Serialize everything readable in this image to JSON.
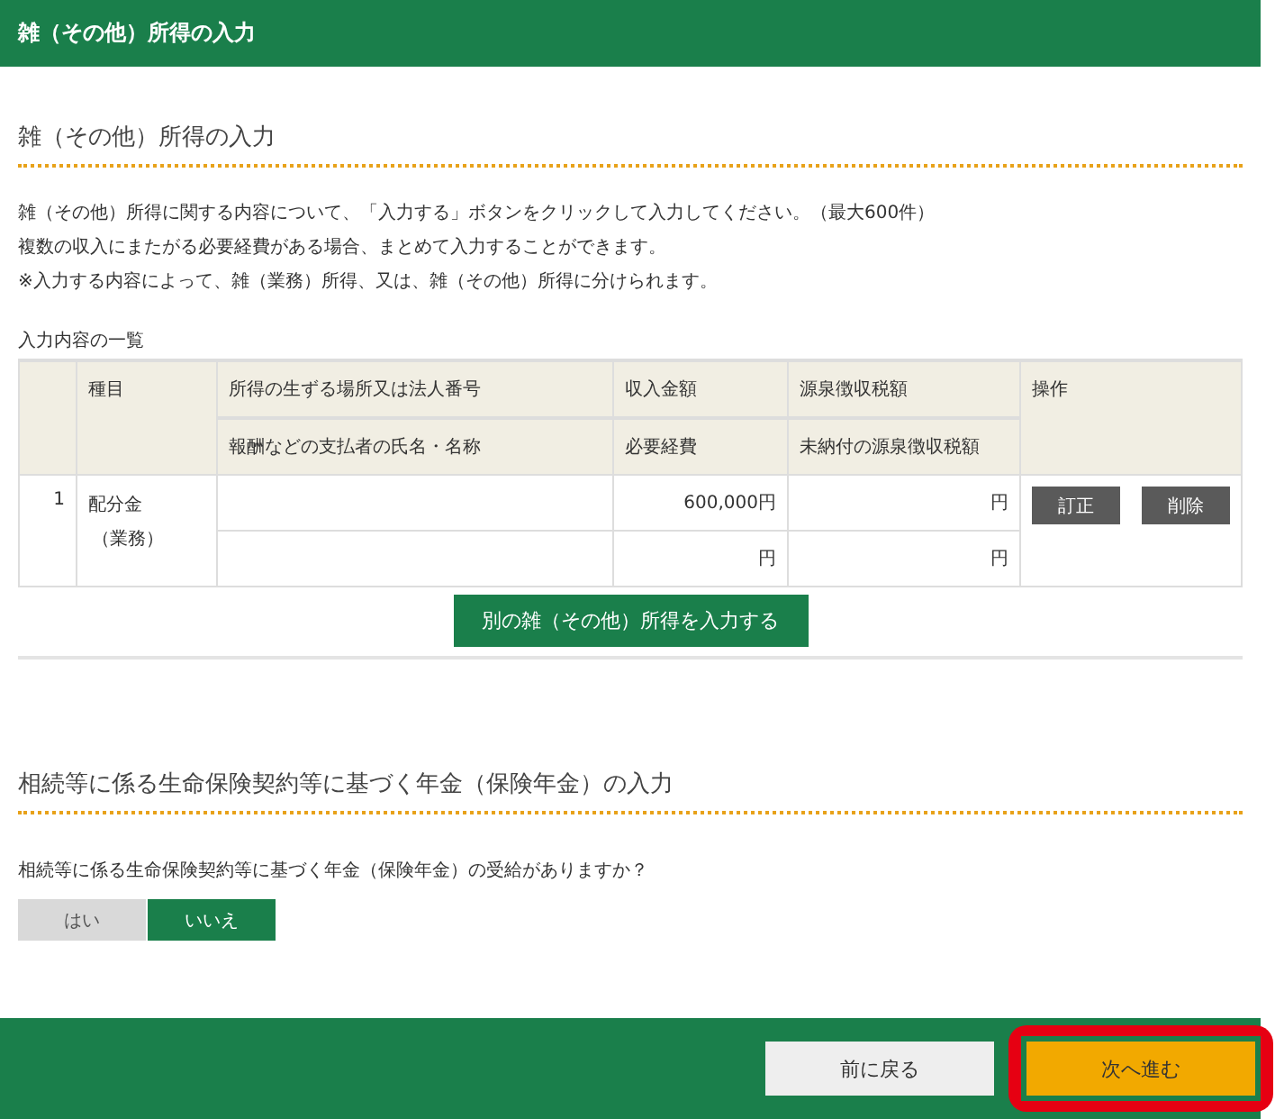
{
  "header": {
    "title": "雑（その他）所得の入力"
  },
  "section1": {
    "title": "雑（その他）所得の入力",
    "paragraphs": [
      "雑（その他）所得に関する内容について、「入力する」ボタンをクリックして入力してください。（最大600件）",
      "複数の収入にまたがる必要経費がある場合、まとめて入力することができます。",
      "※入力する内容によって、雑（業務）所得、又は、雑（その他）所得に分けられます。"
    ],
    "list_label": "入力内容の一覧",
    "table": {
      "headers": {
        "type": "種目",
        "place": "所得の生ずる場所又は法人番号",
        "payer": "報酬などの支払者の氏名・名称",
        "income": "収入金額",
        "expenses": "必要経費",
        "withholding": "源泉徴収税額",
        "unpaid": "未納付の源泉徴収税額",
        "actions": "操作"
      },
      "rows": [
        {
          "no": "1",
          "type": "配分金",
          "type_note": "（業務）",
          "place": "",
          "payer": "",
          "income": "600,000円",
          "expenses": "円",
          "withholding": "円",
          "unpaid": "円",
          "actions": [
            "訂正",
            "削除"
          ]
        }
      ]
    },
    "add_button": "別の雑（その他）所得を入力する"
  },
  "section2": {
    "title": "相続等に係る生命保険契約等に基づく年金（保険年金）の入力",
    "question": "相続等に係る生命保険契約等に基づく年金（保険年金）の受給がありますか？",
    "options": [
      {
        "label": "はい",
        "selected": false
      },
      {
        "label": "いいえ",
        "selected": true
      }
    ]
  },
  "footer": {
    "buttons": [
      {
        "label": "前に戻る",
        "kind": "secondary",
        "highlighted": false
      },
      {
        "label": "次へ進む",
        "kind": "primary",
        "highlighted": true
      }
    ]
  }
}
